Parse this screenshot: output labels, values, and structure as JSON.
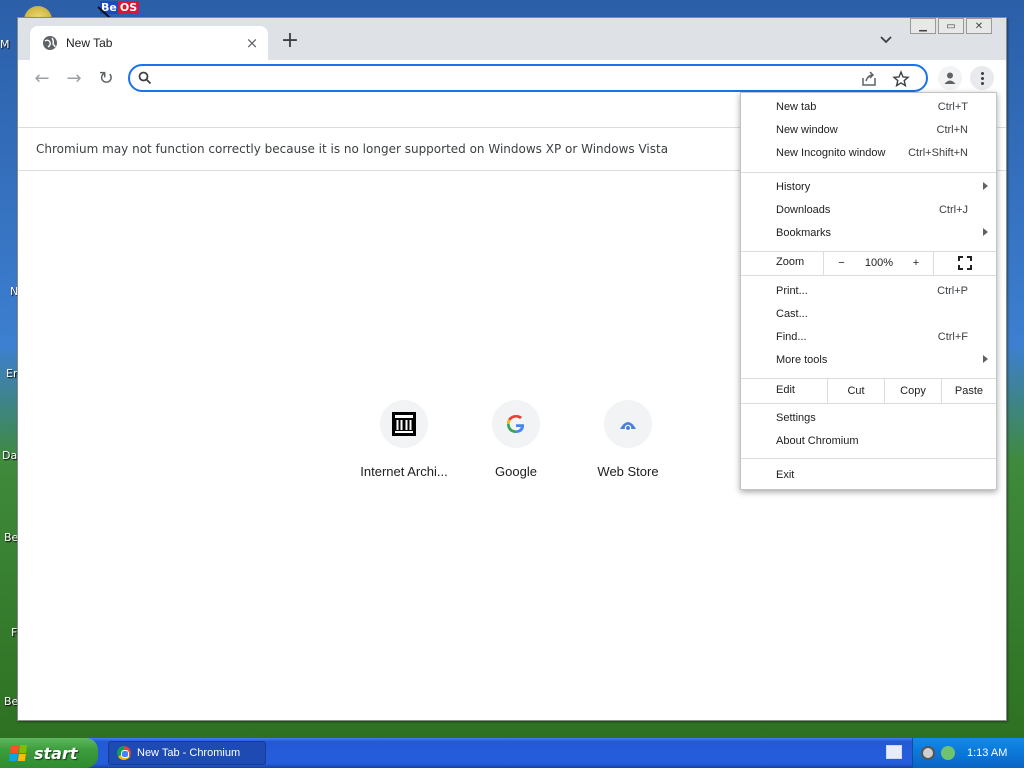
{
  "desktop": {
    "left_labels": [
      "M",
      "N",
      "Er",
      "Da",
      "Be",
      "F",
      "Be"
    ],
    "beos_be": "Be",
    "beos_os": "OS"
  },
  "browser": {
    "tab": {
      "title": "New Tab",
      "favicon": "globe-icon",
      "close": "×"
    },
    "new_tab": "+",
    "tab_search": "chevron-down-icon",
    "window_controls": {
      "minimize": "▁",
      "maximize": "▭",
      "close": "✕"
    },
    "toolbar": {
      "back": "←",
      "forward": "→",
      "reload": "↻",
      "omnibox_value": "",
      "share_icon": "share-icon",
      "bookmark_icon": "star-icon"
    },
    "infobar": "Chromium may not function correctly because it is no longer supported on Windows XP or Windows Vista",
    "shortcuts": [
      {
        "label": "Internet Archi...",
        "icon": "internet-archive-icon"
      },
      {
        "label": "Google",
        "icon": "google-g-icon"
      },
      {
        "label": "Web Store",
        "icon": "web-store-icon"
      }
    ]
  },
  "menu": {
    "new_tab": {
      "label": "New tab",
      "shortcut": "Ctrl+T"
    },
    "new_window": {
      "label": "New window",
      "shortcut": "Ctrl+N"
    },
    "new_incognito": {
      "label": "New Incognito window",
      "shortcut": "Ctrl+Shift+N"
    },
    "history": {
      "label": "History"
    },
    "downloads": {
      "label": "Downloads",
      "shortcut": "Ctrl+J"
    },
    "bookmarks": {
      "label": "Bookmarks"
    },
    "zoom": {
      "label": "Zoom",
      "minus": "−",
      "value": "100%",
      "plus": "+"
    },
    "print": {
      "label": "Print...",
      "shortcut": "Ctrl+P"
    },
    "cast": {
      "label": "Cast..."
    },
    "find": {
      "label": "Find...",
      "shortcut": "Ctrl+F"
    },
    "more_tools": {
      "label": "More tools"
    },
    "edit": {
      "label": "Edit",
      "cut": "Cut",
      "copy": "Copy",
      "paste": "Paste"
    },
    "settings": {
      "label": "Settings"
    },
    "about": {
      "label": "About Chromium"
    },
    "exit": {
      "label": "Exit"
    }
  },
  "taskbar": {
    "start_label": "start",
    "task_item": "New Tab - Chromium",
    "clock": "1:13 AM"
  },
  "colors": {
    "accent": "#1a73e8",
    "taskbar": "#245edc",
    "start": "#3c9c3c"
  }
}
